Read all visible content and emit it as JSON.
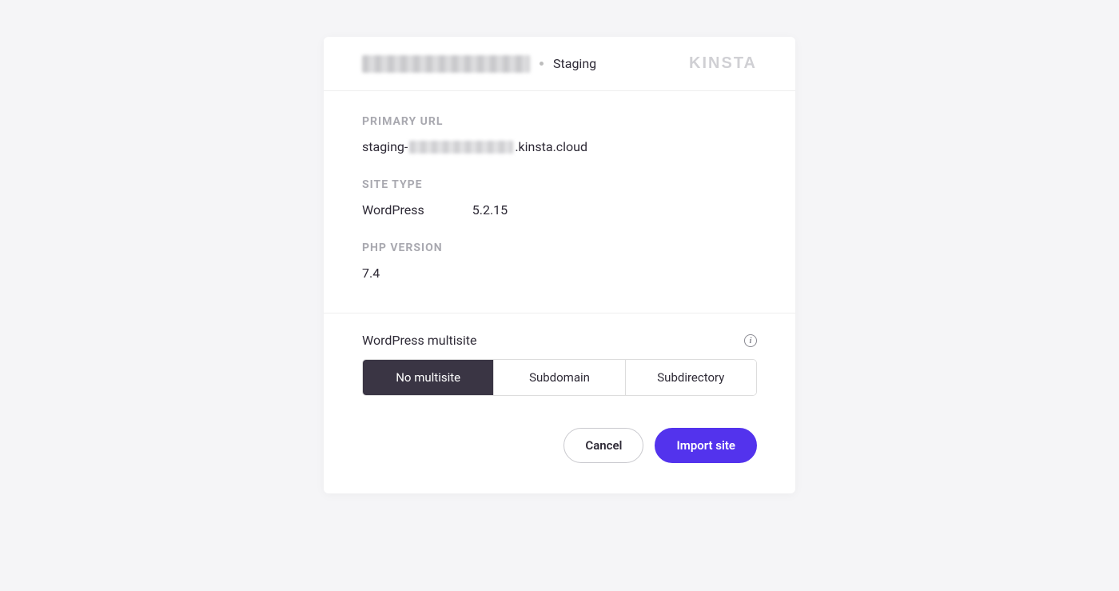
{
  "header": {
    "staging_label": "Staging",
    "brand": "KINSTA"
  },
  "primary_url": {
    "label": "PRIMARY URL",
    "prefix": "staging-",
    "suffix": ".kinsta.cloud"
  },
  "site_type": {
    "label": "SITE TYPE",
    "name": "WordPress",
    "version": "5.2.15"
  },
  "php": {
    "label": "PHP VERSION",
    "version": "7.4"
  },
  "multisite": {
    "label": "WordPress multisite",
    "options": {
      "none": "No multisite",
      "subdomain": "Subdomain",
      "subdirectory": "Subdirectory"
    },
    "selected": "none"
  },
  "footer": {
    "cancel_label": "Cancel",
    "import_label": "Import site"
  },
  "colors": {
    "accent": "#5333ed",
    "segment_active_bg": "#3a3544"
  }
}
